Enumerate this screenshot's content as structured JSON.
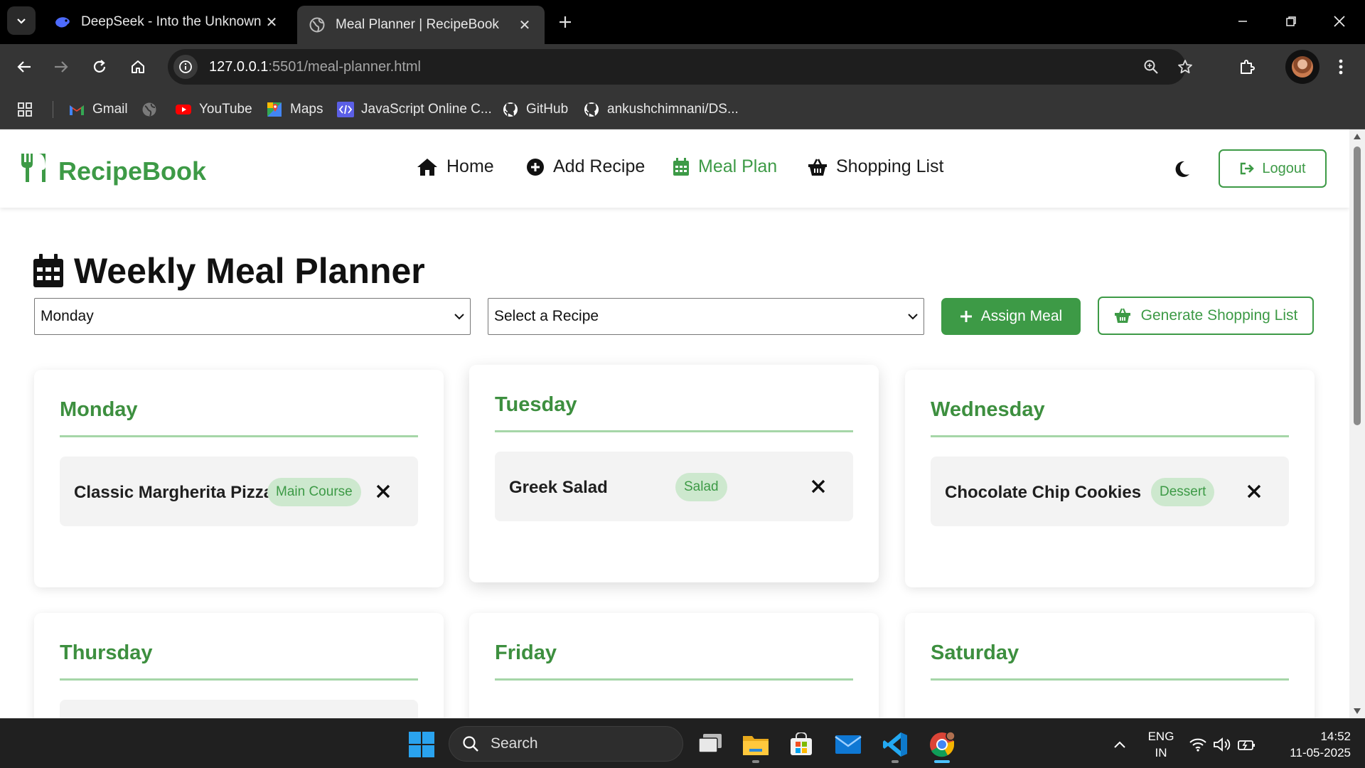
{
  "browser": {
    "tabs": [
      {
        "title": "DeepSeek - Into the Unknown",
        "active": false
      },
      {
        "title": "Meal Planner | RecipeBook",
        "active": true
      }
    ],
    "url_host": "127.0.0.1",
    "url_rest": ":5501/meal-planner.html",
    "bookmarks": [
      "Gmail",
      "",
      "YouTube",
      "Maps",
      "JavaScript Online C...",
      "GitHub",
      "ankushchimnani/DS..."
    ]
  },
  "app": {
    "brand": "RecipeBook",
    "nav": [
      {
        "label": "Home",
        "icon": "home-icon",
        "active": false
      },
      {
        "label": "Add Recipe",
        "icon": "plus-circle-icon",
        "active": false
      },
      {
        "label": "Meal Plan",
        "icon": "calendar-icon",
        "active": true
      },
      {
        "label": "Shopping List",
        "icon": "basket-icon",
        "active": false
      }
    ],
    "logout_label": "Logout",
    "accent_color": "#3d9a46"
  },
  "planner": {
    "title": "Weekly Meal Planner",
    "day_select_value": "Monday",
    "recipe_select_value": "Select a Recipe",
    "assign_label": "Assign Meal",
    "generate_label": "Generate Shopping List",
    "days": [
      {
        "name": "Monday",
        "meal": "Classic Margherita Pizza",
        "tag": "Main Course"
      },
      {
        "name": "Tuesday",
        "meal": "Greek Salad",
        "tag": "Salad"
      },
      {
        "name": "Wednesday",
        "meal": "Chocolate Chip Cookies",
        "tag": "Dessert"
      },
      {
        "name": "Thursday"
      },
      {
        "name": "Friday"
      },
      {
        "name": "Saturday"
      }
    ]
  },
  "taskbar": {
    "search_placeholder": "Search",
    "lang_line1": "ENG",
    "lang_line2": "IN",
    "time": "14:52",
    "date": "11-05-2025"
  }
}
